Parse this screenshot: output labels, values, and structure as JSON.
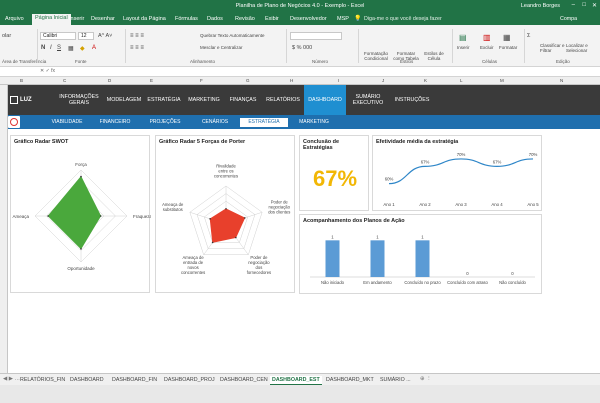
{
  "window": {
    "title": "Planilha de Plano de Negócios 4.0 - Exemplo - Excel",
    "user": "Leandro Borges"
  },
  "ribbon_tabs": [
    {
      "label": "Arquivo"
    },
    {
      "label": "Página Inicial"
    },
    {
      "label": "Inserir"
    },
    {
      "label": "Desenhar"
    },
    {
      "label": "Layout da Página"
    },
    {
      "label": "Fórmulas"
    },
    {
      "label": "Dados"
    },
    {
      "label": "Revisão"
    },
    {
      "label": "Exibir"
    },
    {
      "label": "Desenvolvedor"
    },
    {
      "label": "MSP"
    }
  ],
  "tell_me": "Diga-me o que você deseja fazer",
  "share": "Compa",
  "ribbon": {
    "clipboard_label": "Área de Transferência",
    "paste_label": "olar",
    "font_name": "Calibri",
    "font_size": "12",
    "font_label": "Fonte",
    "wrap_text": "Quebrar Texto Automaticamente",
    "merge_center": "Mesclar e Centralizar",
    "alignment_label": "Alinhamento",
    "number_format": "",
    "number_label": "Número",
    "cond_format": "Formatação Condicional",
    "format_table": "Formatar como Tabela",
    "cell_styles": "Estilos de Célula",
    "styles_label": "Estilos",
    "insert": "Inserir",
    "delete": "Excluir",
    "format": "Formatar",
    "cells_label": "Células",
    "sort_filter": "Classificar e Filtrar",
    "find_select": "Localizar e Selecionar",
    "editing_label": "Edição"
  },
  "columns": [
    "B",
    "C",
    "D",
    "E",
    "F",
    "G",
    "H",
    "I",
    "J",
    "K",
    "L",
    "M",
    "N"
  ],
  "nav": {
    "logo": "LUZ",
    "items": [
      {
        "label": "INFORMAÇÕES GERAIS"
      },
      {
        "label": "MODELAGEM"
      },
      {
        "label": "ESTRATÉGIA"
      },
      {
        "label": "MARKETING"
      },
      {
        "label": "FINANÇAS"
      },
      {
        "label": "RELATÓRIOS"
      },
      {
        "label": "DASHBOARD"
      },
      {
        "label": "SUMÁRIO EXECUTIVO"
      },
      {
        "label": "INSTRUÇÕES"
      }
    ]
  },
  "subnav": [
    {
      "label": "VIABILIDADE"
    },
    {
      "label": "FINANCEIRO"
    },
    {
      "label": "PROJEÇÕES"
    },
    {
      "label": "CENÁRIOS"
    },
    {
      "label": "ESTRATÉGIA"
    },
    {
      "label": "MARKETING"
    }
  ],
  "panels": {
    "swot_title": "Gráfico Radar SWOT",
    "porter_title": "Gráfico Radar 5 Forças de Porter",
    "conclusion_title": "Conclusão de Estratégias",
    "conclusion_value": "67%",
    "efficiency_title": "Efetividade média da estratégia",
    "plans_title": "Acompanhamento dos Planos de Ação"
  },
  "chart_data": [
    {
      "type": "radar",
      "title": "Gráfico Radar SWOT",
      "categories": [
        "Força",
        "Fraqueza",
        "Oportunidade",
        "Ameaça"
      ],
      "values": [
        3,
        1.5,
        2.5,
        2.5
      ],
      "ylim": [
        0,
        3.5
      ],
      "color": "#4aa83c"
    },
    {
      "type": "radar",
      "title": "Gráfico Radar 5 Forças de Porter",
      "categories": [
        "Rivalidade entre os concorrentes",
        "Poder de negociação dos clientes",
        "Poder de negociação dos fornecedores",
        "Ameaça de entrada de novos concorrentes",
        "Ameaça de substitutos"
      ],
      "values": [
        2,
        2.6,
        2.2,
        3,
        2.2
      ],
      "ylim": [
        0,
        5
      ],
      "color": "#e8402c"
    },
    {
      "type": "line",
      "title": "Efetividade média da estratégia",
      "categories": [
        "Ano 1",
        "Ano 2",
        "Ano 3",
        "Ano 4",
        "Ano 5"
      ],
      "values": [
        60,
        67,
        70,
        67,
        70
      ],
      "labels": [
        "60%",
        "67%",
        "70%",
        "67%",
        "70%"
      ],
      "ylim": [
        55,
        72
      ],
      "color": "#2e86c8"
    },
    {
      "type": "bar",
      "title": "Acompanhamento dos Planos de Ação",
      "categories": [
        "Não iniciado",
        "Em andamento",
        "Concluído no prazo",
        "Concluído com atraso",
        "Não concluído"
      ],
      "values": [
        1,
        1,
        1,
        0,
        0
      ],
      "ylim": [
        0,
        1.2
      ],
      "color": "#5b9bd5"
    }
  ],
  "sheet_tabs": [
    {
      "label": "RELATÓRIOS_FIN"
    },
    {
      "label": "DASHBOARD"
    },
    {
      "label": "DASHBOARD_FIN"
    },
    {
      "label": "DASHBOARD_PROJ"
    },
    {
      "label": "DASHBOARD_CEN"
    },
    {
      "label": "DASHBOARD_EST"
    },
    {
      "label": "DASHBOARD_MKT"
    },
    {
      "label": "SUMÁRIO ..."
    }
  ],
  "active_sheet": "DASHBOARD_EST",
  "colors": {
    "excel_green": "#217346",
    "nav_dark": "#3a3a3a",
    "accent_blue": "#1f8fd1",
    "kpi_yellow": "#f2b705"
  }
}
